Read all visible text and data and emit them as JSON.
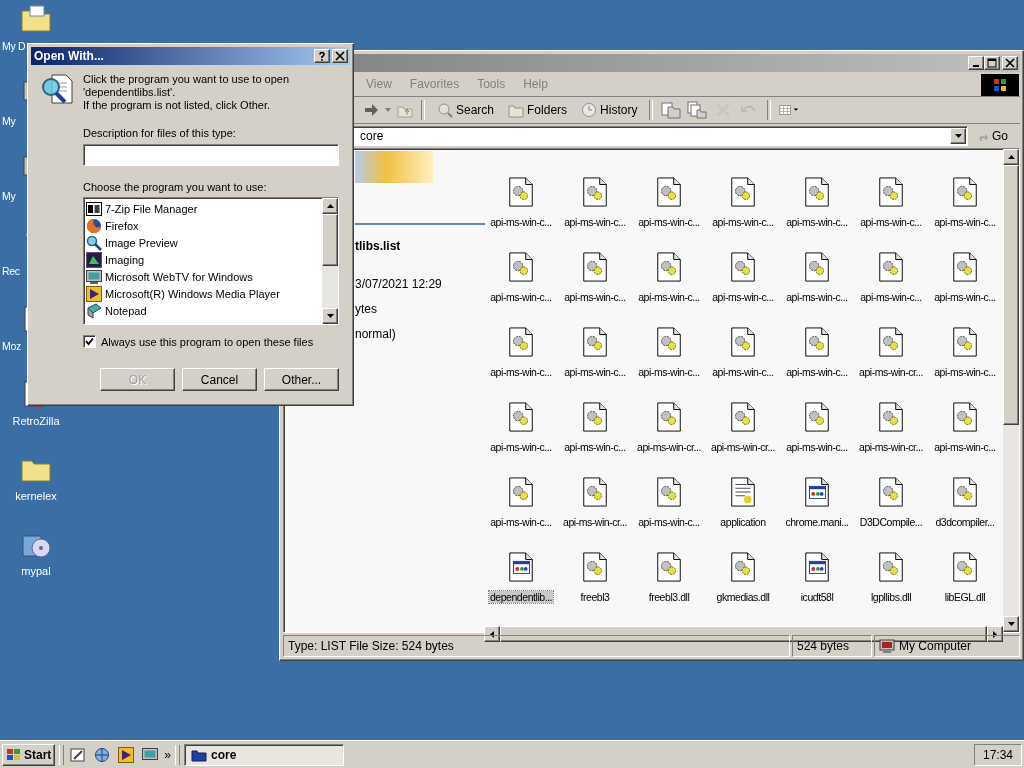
{
  "desktop_icons": [
    {
      "label": "My D",
      "kind": "documents"
    },
    {
      "label": "My",
      "kind": "computer"
    },
    {
      "label": "My",
      "kind": "network"
    },
    {
      "label": "Rec",
      "kind": "recycle"
    },
    {
      "label": "Moz",
      "kind": "browser"
    },
    {
      "label": "RetroZilla",
      "kind": "browser"
    },
    {
      "label": "kernelex",
      "kind": "folder"
    },
    {
      "label": "mypal",
      "kind": "installer"
    }
  ],
  "explorer": {
    "menu": [
      "View",
      "Favorites",
      "Tools",
      "Help"
    ],
    "toolbar": [
      {
        "label": "Search",
        "kind": "search"
      },
      {
        "label": "Folders",
        "kind": "folders"
      },
      {
        "label": "History",
        "kind": "history"
      }
    ],
    "address": "core",
    "go": "Go",
    "details": {
      "name": "tlibs.list",
      "modified": "3/07/2021 12:29",
      "size": "ytes",
      "attributes": "normal)"
    },
    "files": [
      {
        "name": "api-ms-win-c...",
        "kind": "dll",
        "selected": false
      },
      {
        "name": "api-ms-win-c...",
        "kind": "dll",
        "selected": false
      },
      {
        "name": "api-ms-win-c...",
        "kind": "dll",
        "selected": false
      },
      {
        "name": "api-ms-win-c...",
        "kind": "dll",
        "selected": false
      },
      {
        "name": "api-ms-win-c...",
        "kind": "dll",
        "selected": false
      },
      {
        "name": "api-ms-win-c...",
        "kind": "dll",
        "selected": false
      },
      {
        "name": "api-ms-win-c...",
        "kind": "dll",
        "selected": false
      },
      {
        "name": "api-ms-win-c...",
        "kind": "dll",
        "selected": false
      },
      {
        "name": "api-ms-win-c...",
        "kind": "dll",
        "selected": false
      },
      {
        "name": "api-ms-win-c...",
        "kind": "dll",
        "selected": false
      },
      {
        "name": "api-ms-win-c...",
        "kind": "dll",
        "selected": false
      },
      {
        "name": "api-ms-win-c...",
        "kind": "dll",
        "selected": false
      },
      {
        "name": "api-ms-win-c...",
        "kind": "dll",
        "selected": false
      },
      {
        "name": "api-ms-win-c...",
        "kind": "dll",
        "selected": false
      },
      {
        "name": "api-ms-win-c...",
        "kind": "dll",
        "selected": false
      },
      {
        "name": "api-ms-win-c...",
        "kind": "dll",
        "selected": false
      },
      {
        "name": "api-ms-win-c...",
        "kind": "dll",
        "selected": false
      },
      {
        "name": "api-ms-win-c...",
        "kind": "dll",
        "selected": false
      },
      {
        "name": "api-ms-win-c...",
        "kind": "dll",
        "selected": false
      },
      {
        "name": "api-ms-win-cr...",
        "kind": "dll",
        "selected": false
      },
      {
        "name": "api-ms-win-c...",
        "kind": "dll",
        "selected": false
      },
      {
        "name": "api-ms-win-c...",
        "kind": "dll",
        "selected": false
      },
      {
        "name": "api-ms-win-c...",
        "kind": "dll",
        "selected": false
      },
      {
        "name": "api-ms-win-cr...",
        "kind": "dll",
        "selected": false
      },
      {
        "name": "api-ms-win-cr...",
        "kind": "dll",
        "selected": false
      },
      {
        "name": "api-ms-win-c...",
        "kind": "dll",
        "selected": false
      },
      {
        "name": "api-ms-win-cr...",
        "kind": "dll",
        "selected": false
      },
      {
        "name": "api-ms-win-c...",
        "kind": "dll",
        "selected": false
      },
      {
        "name": "api-ms-win-c...",
        "kind": "dll",
        "selected": false
      },
      {
        "name": "api-ms-win-cr...",
        "kind": "dll",
        "selected": false
      },
      {
        "name": "api-ms-win-c...",
        "kind": "dll",
        "selected": false
      },
      {
        "name": "application",
        "kind": "app",
        "selected": false
      },
      {
        "name": "chrome.mani...",
        "kind": "window",
        "selected": false
      },
      {
        "name": "D3DCompile...",
        "kind": "dll",
        "selected": false
      },
      {
        "name": "d3dcompiler...",
        "kind": "dll",
        "selected": false
      },
      {
        "name": "dependentlib...",
        "kind": "window",
        "selected": true
      },
      {
        "name": "freebl3",
        "kind": "dll",
        "selected": false
      },
      {
        "name": "freebl3.dll",
        "kind": "dll",
        "selected": false
      },
      {
        "name": "gkmedias.dll",
        "kind": "dll",
        "selected": false
      },
      {
        "name": "icudt58l",
        "kind": "window",
        "selected": false
      },
      {
        "name": "lgpllibs.dll",
        "kind": "dll",
        "selected": false
      },
      {
        "name": "libEGL.dll",
        "kind": "dll",
        "selected": false
      }
    ],
    "status": {
      "info": "Type: LIST File Size: 524 bytes",
      "size": "524 bytes",
      "zone": "My Computer"
    }
  },
  "dialog": {
    "title": "Open With...",
    "message": "Click the program you want to use to open\n'dependentlibs.list'.\nIf the program is not listed, click Other.",
    "description_label": "Description for files of this type:",
    "programs_label": "Choose the program you want to use:",
    "programs": [
      {
        "label": "7-Zip File Manager",
        "kind": "archive",
        "selected": false
      },
      {
        "label": "Firefox",
        "kind": "browser",
        "selected": false
      },
      {
        "label": "Image Preview",
        "kind": "viewer",
        "selected": false
      },
      {
        "label": "Imaging",
        "kind": "imaging",
        "selected": false
      },
      {
        "label": "Microsoft WebTV for Windows",
        "kind": "tv",
        "selected": false
      },
      {
        "label": "Microsoft(R) Windows Media Player",
        "kind": "player",
        "selected": false
      },
      {
        "label": "Notepad",
        "kind": "notepad",
        "selected": false
      }
    ],
    "always_use": {
      "label": "Always use this program to open these files",
      "checked": true
    },
    "buttons": [
      {
        "label": "OK",
        "disabled": true
      },
      {
        "label": "Cancel",
        "disabled": false
      },
      {
        "label": "Other...",
        "disabled": false
      }
    ]
  },
  "taskbar": {
    "start": "Start",
    "more": "»",
    "tasks": [
      {
        "label": "core",
        "selected": true
      }
    ],
    "clock": "17:34"
  }
}
